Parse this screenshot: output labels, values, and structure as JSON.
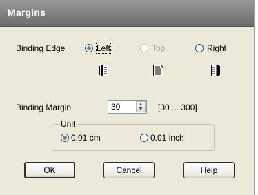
{
  "window": {
    "title": "Margins"
  },
  "binding_edge": {
    "label": "Binding Edge",
    "options": [
      {
        "label": "Left",
        "selected": true,
        "enabled": true,
        "icon": "document-left-bound-icon"
      },
      {
        "label": "Top",
        "selected": false,
        "enabled": false,
        "icon": "document-top-bound-icon"
      },
      {
        "label": "Right",
        "selected": false,
        "enabled": true,
        "icon": "document-right-bound-icon"
      }
    ]
  },
  "binding_margin": {
    "label": "Binding Margin",
    "value": "30",
    "range": "[30 ... 300]"
  },
  "unit": {
    "label": "Unit",
    "options": [
      {
        "label": "0.01 cm",
        "selected": true
      },
      {
        "label": "0.01 inch",
        "selected": false
      }
    ]
  },
  "buttons": {
    "ok": "OK",
    "cancel": "Cancel",
    "help": "Help"
  }
}
